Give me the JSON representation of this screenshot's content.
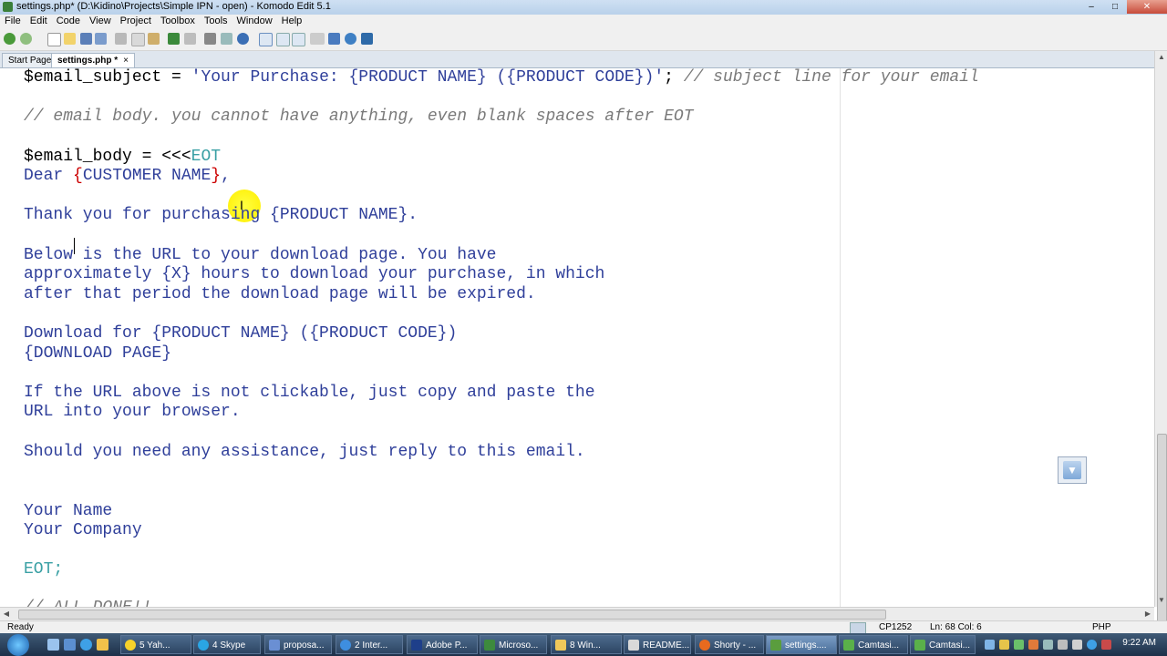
{
  "window": {
    "title": "settings.php* (D:\\Kidino\\Projects\\Simple IPN - open) - Komodo Edit 5.1"
  },
  "menu": [
    "File",
    "Edit",
    "Code",
    "View",
    "Project",
    "Toolbox",
    "Tools",
    "Window",
    "Help"
  ],
  "tabs": [
    {
      "label": "Start Page"
    },
    {
      "label": "settings.php *",
      "close": "×"
    }
  ],
  "code": {
    "line1_var": "$email_subject",
    "line1_eq": " = ",
    "line1_str": "'Your Purchase: {PRODUCT NAME} ({PRODUCT CODE})'",
    "line1_semi": "; ",
    "line1_cmt": "// subject line for your email",
    "line3_cmt": "// email body. you cannot have anything, even blank spaces after EOT",
    "line5_var": "$email_body = <<<",
    "line5_eot": "EOT",
    "line6_a": "Dear ",
    "line6_b": "{",
    "line6_c": "CUSTOMER NAME",
    "line6_d": "}",
    "line6_e": ",",
    "line8": "Thank you for purchasing {PRODUCT NAME}.",
    "line10": "Below is the URL to your download page. You have",
    "line11": "approximately {X} hours to download your purchase, in which",
    "line12": "after that period the download page will be expired.",
    "line14": "Download for {PRODUCT NAME} ({PRODUCT CODE})",
    "line15": "{DOWNLOAD PAGE}",
    "line17": "If the URL above is not clickable, just copy and paste the",
    "line18": "URL into your browser.",
    "line20": "Should you need any assistance, just reply to this email.",
    "line23": "Your Name",
    "line24": "Your Company",
    "line26": "EOT;",
    "line28": "// ALL DONE!!"
  },
  "status": {
    "ready": "Ready",
    "encoding": "CP1252",
    "position": "Ln: 68 Col: 6",
    "language": "PHP"
  },
  "taskbar": {
    "items": [
      "5 Yah...",
      "4 Skype",
      "proposa...",
      "2 Inter...",
      "Adobe P...",
      "Microso...",
      "8 Win...",
      "README...",
      "Shorty - ...",
      "settings....",
      "Camtasi...",
      "Camtasi..."
    ],
    "clock": "9:22 AM"
  }
}
